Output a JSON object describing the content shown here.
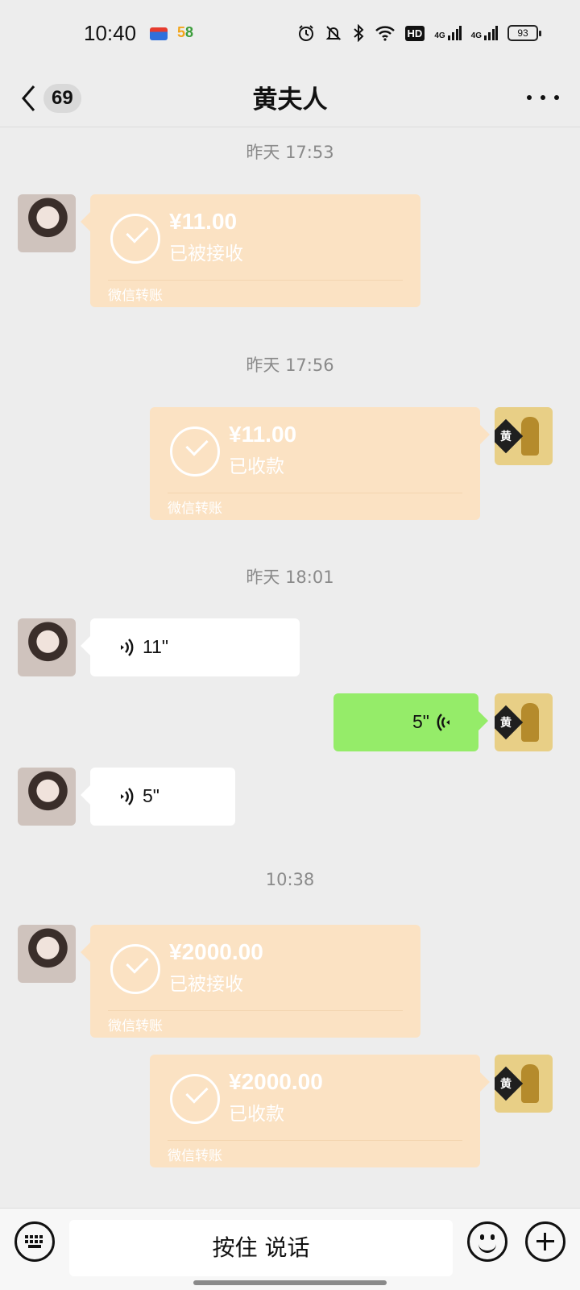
{
  "status_bar": {
    "time": "10:40",
    "app_icon_b": [
      "5",
      "8"
    ],
    "hd_label": "HD",
    "network_1": "4G",
    "network_2": "4G",
    "battery": "93"
  },
  "header": {
    "unread_count": "69",
    "title": "黄夫人"
  },
  "messages": {
    "ts1": "昨天 17:53",
    "t1": {
      "amount": "¥11.00",
      "status": "已被接收",
      "label": "微信转账"
    },
    "ts2": "昨天 17:56",
    "t2": {
      "amount": "¥11.00",
      "status": "已收款",
      "label": "微信转账"
    },
    "ts3": "昨天 18:01",
    "v1": {
      "duration": "11\""
    },
    "v2": {
      "duration": "5\""
    },
    "v3": {
      "duration": "5\""
    },
    "ts4": "10:38",
    "t3": {
      "amount": "¥2000.00",
      "status": "已被接收",
      "label": "微信转账"
    },
    "t4": {
      "amount": "¥2000.00",
      "status": "已收款",
      "label": "微信转账"
    }
  },
  "self_avatar_text": "黄",
  "bottom": {
    "hold_to_talk": "按住 说话"
  },
  "colors": {
    "transfer_bg": "#fbe2c3",
    "mine_bubble": "#95ec69",
    "page_bg": "#ededed"
  }
}
